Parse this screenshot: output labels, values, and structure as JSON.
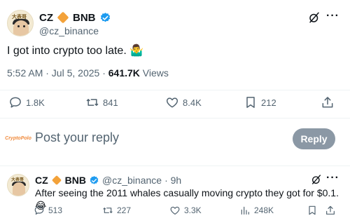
{
  "post": {
    "author_name": "CZ",
    "author_suffix": "BNB",
    "handle": "@cz_binance",
    "avatar_caption": "大表哥",
    "text": "I got into crypto too late. 🤷‍♂️",
    "time": "5:52 AM · Jul 5, 2025 · ",
    "views_count": "641.7K",
    "views_label": " Views",
    "actions": {
      "replies": "1.8K",
      "reposts": "841",
      "likes": "8.4K",
      "bookmarks": "212"
    }
  },
  "reply_box": {
    "logo_text": "CryptoPolo",
    "placeholder": "Post your reply",
    "button": "Reply"
  },
  "reply": {
    "author_name": "CZ",
    "author_suffix": "BNB",
    "handle": "@cz_binance",
    "time": "· 9h",
    "avatar_caption": "大表哥",
    "text": "After seeing the 2011 whales casually moving crypto they got for $0.1. 😂",
    "actions": {
      "replies": "513",
      "reposts": "227",
      "likes": "3.3K",
      "views": "248K"
    }
  },
  "colors": {
    "verified": "#1d9bf0",
    "diamond": "#f3a23a",
    "muted": "#536471",
    "reply_button": "#8b98a5"
  }
}
